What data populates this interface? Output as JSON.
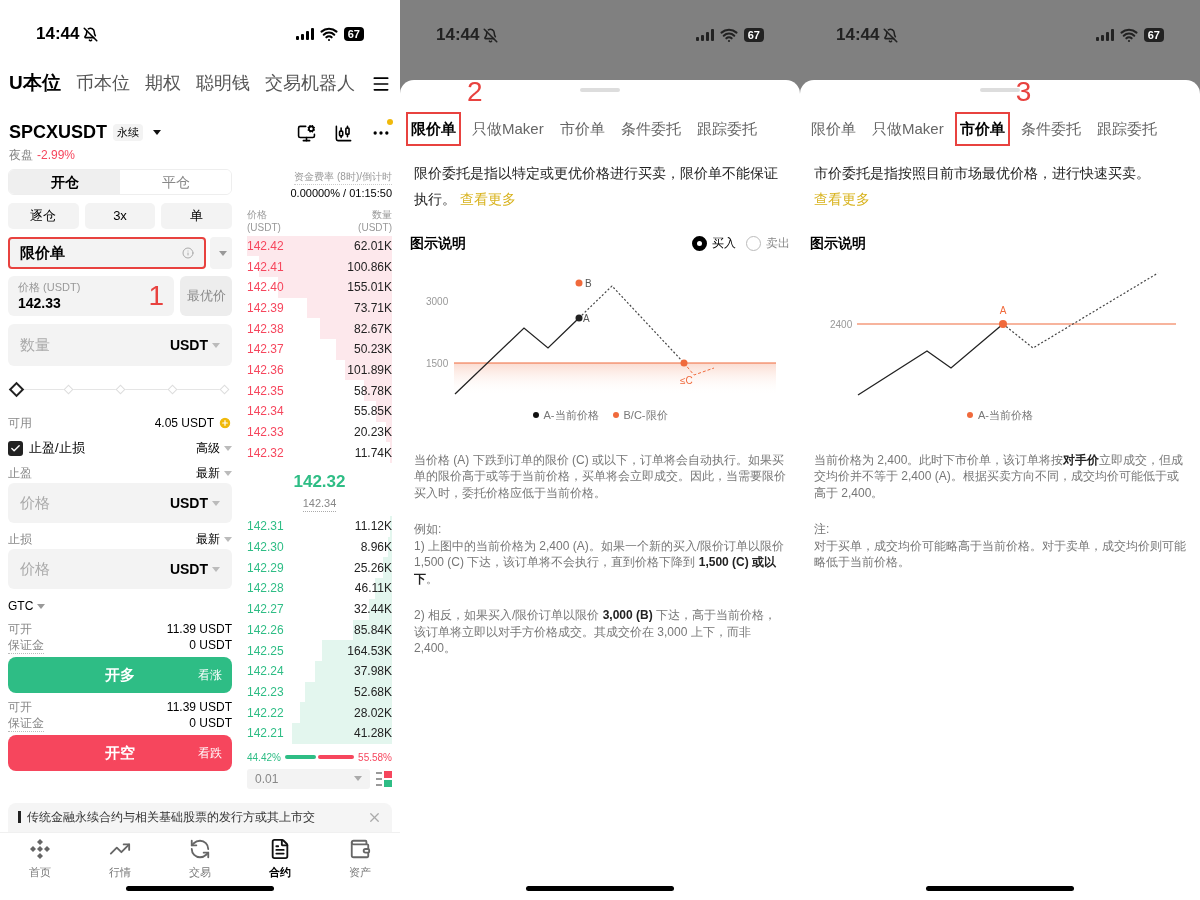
{
  "screens": [
    {
      "kind": "trade",
      "status_bar": {
        "time": "14:44",
        "battery": "67"
      },
      "top_tabs": [
        {
          "label": "U本位",
          "selected": true
        },
        {
          "label": "币本位",
          "selected": false
        },
        {
          "label": "期权",
          "selected": false
        },
        {
          "label": "聪明钱",
          "selected": false
        },
        {
          "label": "交易机器人",
          "selected": false
        }
      ],
      "symbol": {
        "name": "SPCXUSDT",
        "badge": "永续",
        "session": "夜盘",
        "change": "-2.99%"
      },
      "position_tabs": [
        {
          "label": "开仓",
          "selected": true
        },
        {
          "label": "平仓",
          "selected": false
        }
      ],
      "margin_options": [
        "逐仓",
        "3x",
        "单"
      ],
      "order_type": {
        "value": "限价单",
        "highlighted": true,
        "annotation": "1"
      },
      "price_field": {
        "label": "价格 (USDT)",
        "value": "142.33"
      },
      "best_price_button": {
        "label": "最优价",
        "disabled": true
      },
      "quantity_field": {
        "placeholder": "数量",
        "unit": "USDT"
      },
      "slider": {
        "level": 0
      },
      "available": {
        "label": "可用",
        "value": "4.05 USDT"
      },
      "tp_sl": {
        "label": "止盈/止损",
        "checked": true,
        "mode": "高级"
      },
      "tp_sl_fields": [
        {
          "label": "止盈",
          "trigger": "最新",
          "placeholder": "价格",
          "unit": "USDT"
        },
        {
          "label": "止损",
          "trigger": "最新",
          "placeholder": "价格",
          "unit": "USDT"
        }
      ],
      "time_in_force": "GTC",
      "actions": [
        {
          "kind": "long",
          "open_label": "可开",
          "open_value": "11.39 USDT",
          "margin_label": "保证金",
          "margin_value": "0 USDT",
          "button": "开多",
          "hint": "看涨"
        },
        {
          "kind": "short",
          "open_label": "可开",
          "open_value": "11.39 USDT",
          "margin_label": "保证金",
          "margin_value": "0 USDT",
          "button": "开空",
          "hint": "看跌"
        }
      ],
      "order_book": {
        "funding_label": "资金费率 (8时)/倒计时",
        "funding_value": "0.00000% / 01:15:50",
        "columns": [
          {
            "title": "价格",
            "unit": "(USDT)"
          },
          {
            "title": "数量",
            "unit": "(USDT)"
          }
        ],
        "asks": [
          {
            "price": "142.42",
            "amount": "62.01K"
          },
          {
            "price": "142.41",
            "amount": "100.86K"
          },
          {
            "price": "142.40",
            "amount": "155.01K"
          },
          {
            "price": "142.39",
            "amount": "73.71K"
          },
          {
            "price": "142.38",
            "amount": "82.67K"
          },
          {
            "price": "142.37",
            "amount": "50.23K"
          },
          {
            "price": "142.36",
            "amount": "101.89K"
          },
          {
            "price": "142.35",
            "amount": "58.78K"
          },
          {
            "price": "142.34",
            "amount": "55.85K"
          },
          {
            "price": "142.33",
            "amount": "20.23K"
          },
          {
            "price": "142.32",
            "amount": "11.74K"
          }
        ],
        "last_price": "142.32",
        "mark_price": "142.34",
        "bids": [
          {
            "price": "142.31",
            "amount": "11.12K"
          },
          {
            "price": "142.30",
            "amount": "8.96K"
          },
          {
            "price": "142.29",
            "amount": "25.26K"
          },
          {
            "price": "142.28",
            "amount": "46.11K"
          },
          {
            "price": "142.27",
            "amount": "32.44K"
          },
          {
            "price": "142.26",
            "amount": "85.84K"
          },
          {
            "price": "142.25",
            "amount": "164.53K"
          },
          {
            "price": "142.24",
            "amount": "37.98K"
          },
          {
            "price": "142.23",
            "amount": "52.68K"
          },
          {
            "price": "142.22",
            "amount": "28.02K"
          },
          {
            "price": "142.21",
            "amount": "41.28K"
          }
        ],
        "buy_ratio": "44.42%",
        "sell_ratio": "55.58%",
        "precision": "0.01"
      },
      "notice": {
        "text": "传统金融永续合约与相关基础股票的发行方或其上市交"
      },
      "bottom_nav": [
        {
          "label": "首页",
          "selected": false
        },
        {
          "label": "行情",
          "selected": false
        },
        {
          "label": "交易",
          "selected": false
        },
        {
          "label": "合约",
          "selected": true
        },
        {
          "label": "资产",
          "selected": false
        }
      ]
    },
    {
      "kind": "sheet",
      "status_bar": {
        "time": "14:44",
        "battery": "67"
      },
      "tabs": [
        {
          "label": "限价单",
          "selected": true,
          "highlighted": true
        },
        {
          "label": "只做Maker",
          "selected": false,
          "highlighted": false
        },
        {
          "label": "市价单",
          "selected": false,
          "highlighted": false
        },
        {
          "label": "条件委托",
          "selected": false,
          "highlighted": false
        },
        {
          "label": "跟踪委托",
          "selected": false,
          "highlighted": false
        }
      ],
      "annotation": "2",
      "description": "限价委托是指以特定或更优价格进行买卖，限价单不能保证执行。",
      "link": "查看更多",
      "diagram_title": "图示说明",
      "sides": [
        {
          "label": "买入",
          "selected": true
        },
        {
          "label": "卖出",
          "selected": false
        }
      ],
      "diagram": {
        "kind": "limit",
        "ticks": [
          "3000",
          "1500"
        ],
        "points": [
          {
            "label": "B",
            "color": "#f06a3c"
          },
          {
            "label": "A",
            "color": "#222222"
          },
          {
            "label": "≤C",
            "color": "#f06a3c"
          }
        ],
        "legend": [
          {
            "label": "A-当前价格",
            "color": "#111111"
          },
          {
            "label": "B/C-限价",
            "color": "#f06a3c"
          }
        ]
      },
      "blocks": [
        [
          "当价格 (A) 下跌到订单的限价 (C) 或以下，订单将会自动执行。如果买单的限价高于或等于当前价格，买单将会立即成交。因此，当需要限价买入时，委托价格应低于当前价格。"
        ],
        [
          "例如:",
          "1) 上图中的当前价格为 2,400 (A)。如果一个新的买入/限价订单以限价 1,500 (C) 下达，该订单将不会执行，直到价格下降到 **1,500 (C) 或以下**。"
        ],
        [
          "2) 相反，如果买入/限价订单以限价 **3,000 (B)** 下达，高于当前价格，该订单将立即以对手方价格成交。其成交价在 3,000 上下，而非 2,400。"
        ]
      ]
    },
    {
      "kind": "sheet",
      "status_bar": {
        "time": "14:44",
        "battery": "67"
      },
      "tabs": [
        {
          "label": "限价单",
          "selected": false,
          "highlighted": false
        },
        {
          "label": "只做Maker",
          "selected": false,
          "highlighted": false
        },
        {
          "label": "市价单",
          "selected": true,
          "highlighted": true
        },
        {
          "label": "条件委托",
          "selected": false,
          "highlighted": false
        },
        {
          "label": "跟踪委托",
          "selected": false,
          "highlighted": false
        }
      ],
      "annotation": "3",
      "description": "市价委托是指按照目前市场最优价格，进行快速买卖。",
      "link": "查看更多",
      "diagram_title": "图示说明",
      "diagram": {
        "kind": "market",
        "ticks": [
          "2400"
        ],
        "points": [
          {
            "label": "A",
            "color": "#f06a3c"
          }
        ],
        "legend": [
          {
            "label": "A-当前价格",
            "color": "#f06a3c"
          }
        ]
      },
      "blocks": [
        [
          "当前价格为 2,400。此时下市价单，该订单将按**对手价**立即成交，但成交均价并不等于 2,400 (A)。根据买卖方向不同，成交均价可能低于或高于 2,400。"
        ],
        [
          "注:",
          "对于买单，成交均价可能略高于当前价格。对于卖单，成交均价则可能略低于当前价格。"
        ]
      ]
    }
  ]
}
